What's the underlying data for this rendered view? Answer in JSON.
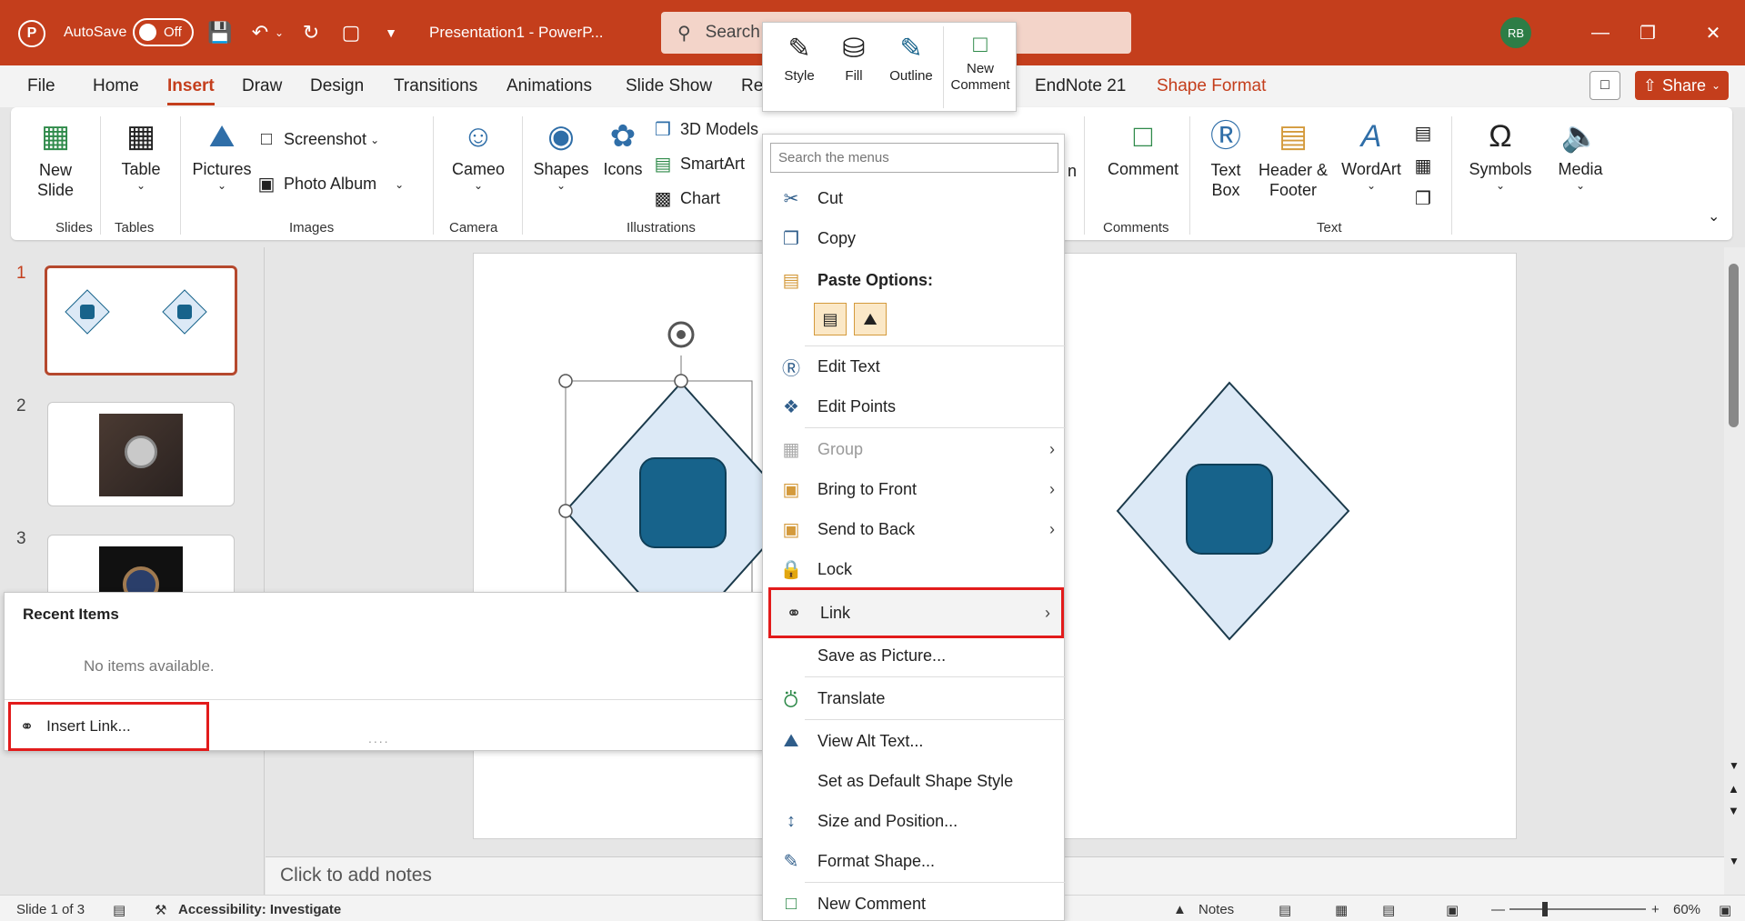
{
  "titlebar": {
    "autosave_label": "AutoSave",
    "autosave_state": "Off",
    "doc_title": "Presentation1  -  PowerP...",
    "search_placeholder": "Search",
    "avatar_initials": "RB"
  },
  "tabs": [
    {
      "label": "File"
    },
    {
      "label": "Home"
    },
    {
      "label": "Insert"
    },
    {
      "label": "Draw"
    },
    {
      "label": "Design"
    },
    {
      "label": "Transitions"
    },
    {
      "label": "Animations"
    },
    {
      "label": "Slide Show"
    },
    {
      "label": "Re"
    },
    {
      "label": "EndNote 21"
    },
    {
      "label": "Shape Format"
    }
  ],
  "share_label": "Share",
  "ribbon": {
    "new_slide": "New Slide",
    "table": "Table",
    "pictures": "Pictures",
    "screenshot": "Screenshot",
    "photo_album": "Photo Album",
    "cameo": "Cameo",
    "shapes": "Shapes",
    "icons": "Icons",
    "models_3d": "3D Models",
    "smartart": "SmartArt",
    "chart": "Chart",
    "comment": "Comment",
    "text_box": "Text Box",
    "header_footer": "Header & Footer",
    "wordart": "WordArt",
    "symbols": "Symbols",
    "media": "Media",
    "groups": {
      "slides": "Slides",
      "tables": "Tables",
      "images": "Images",
      "camera": "Camera",
      "illustrations": "Illustrations",
      "comments": "Comments",
      "text": "Text"
    },
    "partial_h": "n"
  },
  "thumbnails": [
    {
      "number": "1"
    },
    {
      "number": "2"
    },
    {
      "number": "3"
    }
  ],
  "notes_placeholder": "Click to add notes",
  "status": {
    "slide_info": "Slide 1 of 3",
    "accessibility": "Accessibility: Investigate",
    "notes": "Notes",
    "zoom": "60%"
  },
  "link_flyout": {
    "title": "Recent Items",
    "empty": "No items available.",
    "insert_link": "Insert Link..."
  },
  "mini_toolbar": {
    "style": "Style",
    "fill": "Fill",
    "outline": "Outline",
    "new_comment": "New Comment"
  },
  "context_menu": {
    "search_placeholder": "Search the menus",
    "cut": "Cut",
    "copy": "Copy",
    "paste_options": "Paste Options:",
    "edit_text": "Edit Text",
    "edit_points": "Edit Points",
    "group": "Group",
    "bring_to_front": "Bring to Front",
    "send_to_back": "Send to Back",
    "lock": "Lock",
    "link": "Link",
    "save_as_picture": "Save as Picture...",
    "translate": "Translate",
    "view_alt_text": "View Alt Text...",
    "set_default_style": "Set as Default Shape Style",
    "size_position": "Size and Position...",
    "format_shape": "Format Shape...",
    "new_comment": "New Comment"
  },
  "colors": {
    "accent": "#c43e1c",
    "shape_fill": "#dce9f6",
    "shape_inner": "#17638b",
    "highlight_red": "#e21b1b"
  }
}
